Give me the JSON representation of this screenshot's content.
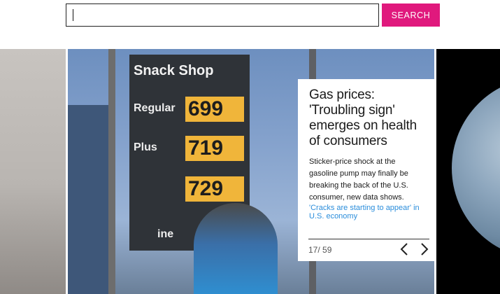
{
  "search": {
    "placeholder": "",
    "value": "",
    "button_label": "SEARCH",
    "button_color": "#e0197d"
  },
  "slide": {
    "title": "Gas prices: 'Troubling sign' emerges on health of consumers",
    "description": "Sticker-price shock at the gasoline pump may finally be breaking the back of the U.S. consumer, new data shows.",
    "link_text": "'Cracks are starting to appear' in U.S. economy",
    "link_color": "#2a8ddb",
    "counter": "17/ 59",
    "photo": {
      "sign_title": "Snack Shop",
      "rows": [
        {
          "label": "Regular",
          "price": "699"
        },
        {
          "label": "Plus",
          "price": "719"
        },
        {
          "label": "",
          "price": "729"
        }
      ],
      "bottom_label": "ine"
    }
  },
  "icons": {
    "prev": "chevron-left-icon",
    "next": "chevron-right-icon"
  }
}
